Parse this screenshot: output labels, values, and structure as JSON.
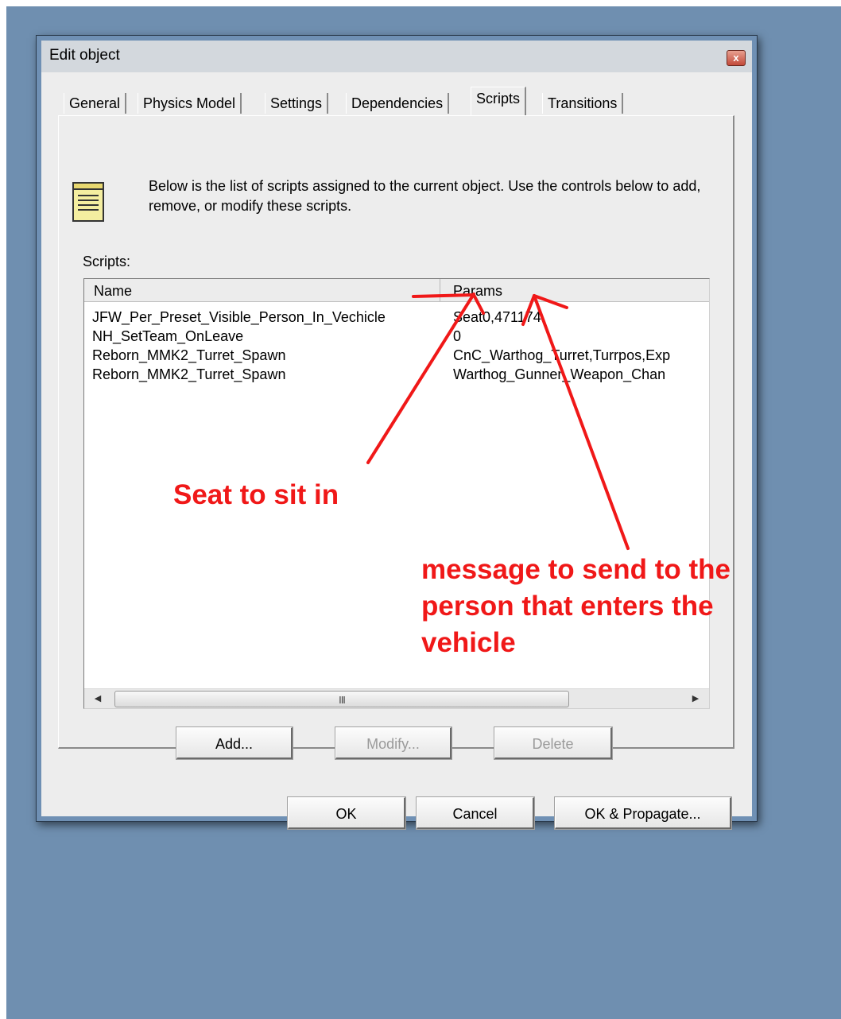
{
  "window": {
    "title": "Edit object",
    "close_glyph": "x"
  },
  "tabs": [
    "General",
    "Physics Model",
    "Settings",
    "Dependencies",
    "Scripts",
    "Transitions"
  ],
  "active_tab": "Scripts",
  "panel": {
    "description": "Below is the list of scripts assigned to the current object.  Use the controls below to add, remove, or modify these scripts.",
    "scripts_label": "Scripts:",
    "icon": "notepad-icon"
  },
  "list": {
    "columns": [
      "Name",
      "Params"
    ],
    "rows": [
      {
        "name": "JFW_Per_Preset_Visible_Person_In_Vechicle",
        "params": "Seat0,471174"
      },
      {
        "name": "NH_SetTeam_OnLeave",
        "params": "0"
      },
      {
        "name": "Reborn_MMK2_Turret_Spawn",
        "params": "CnC_Warthog_Turret,Turrpos,Exp"
      },
      {
        "name": "Reborn_MMK2_Turret_Spawn",
        "params": "Warthog_Gunner_Weapon_Chan"
      }
    ],
    "scroll_grip": "III"
  },
  "buttons": {
    "add": "Add...",
    "modify": "Modify...",
    "delete": "Delete",
    "ok": "OK",
    "cancel": "Cancel",
    "ok_propagate": "OK & Propagate..."
  },
  "annotations": {
    "seat": "Seat to sit in",
    "message_line1": "message to send to the",
    "message_line2": "person that enters the",
    "message_line3": "vehicle",
    "color": "#f01818"
  }
}
